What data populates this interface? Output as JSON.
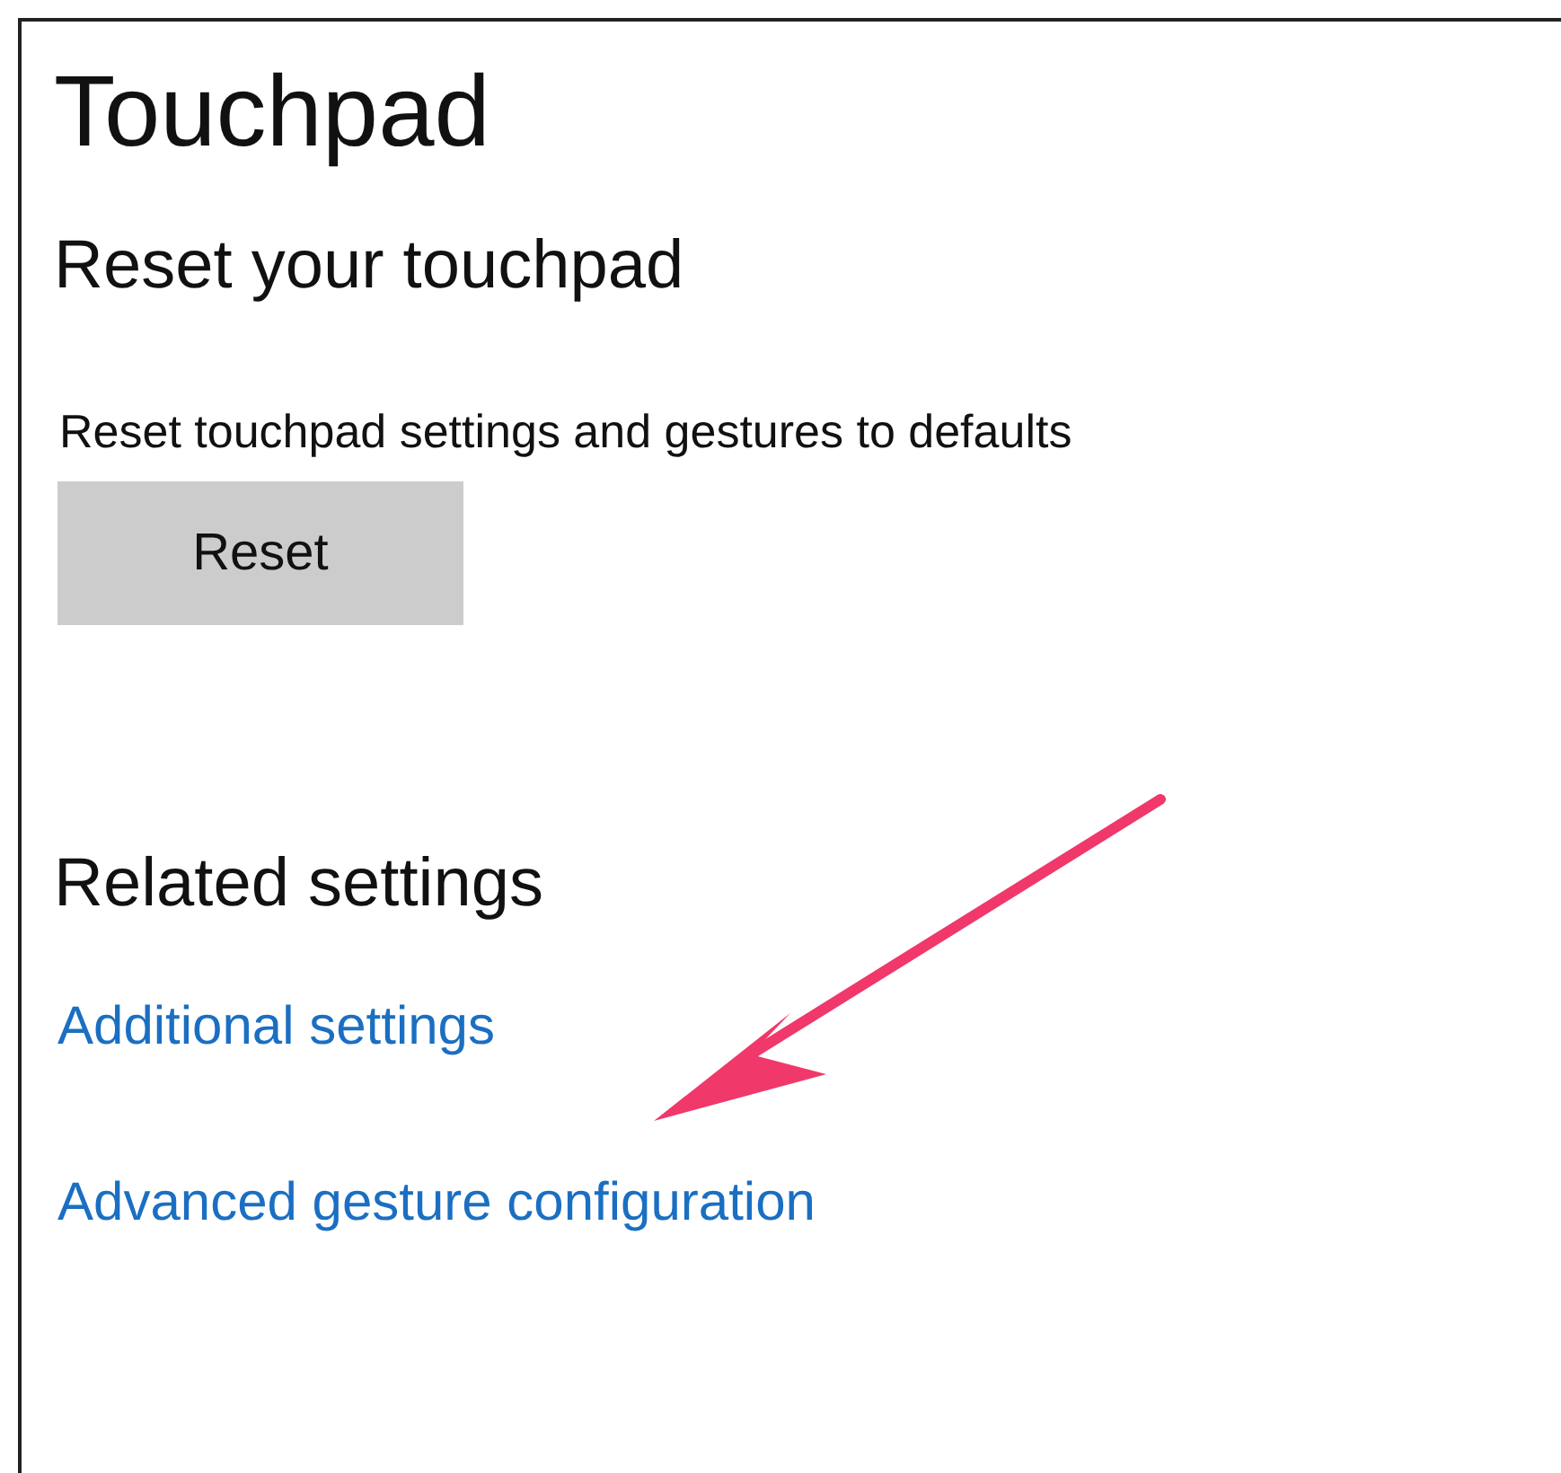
{
  "title": "Touchpad",
  "reset_section": {
    "heading": "Reset your touchpad",
    "description": "Reset touchpad settings and gestures to defaults",
    "button": "Reset"
  },
  "related_section": {
    "heading": "Related settings",
    "links": [
      "Additional settings",
      "Advanced gesture configuration"
    ]
  }
}
